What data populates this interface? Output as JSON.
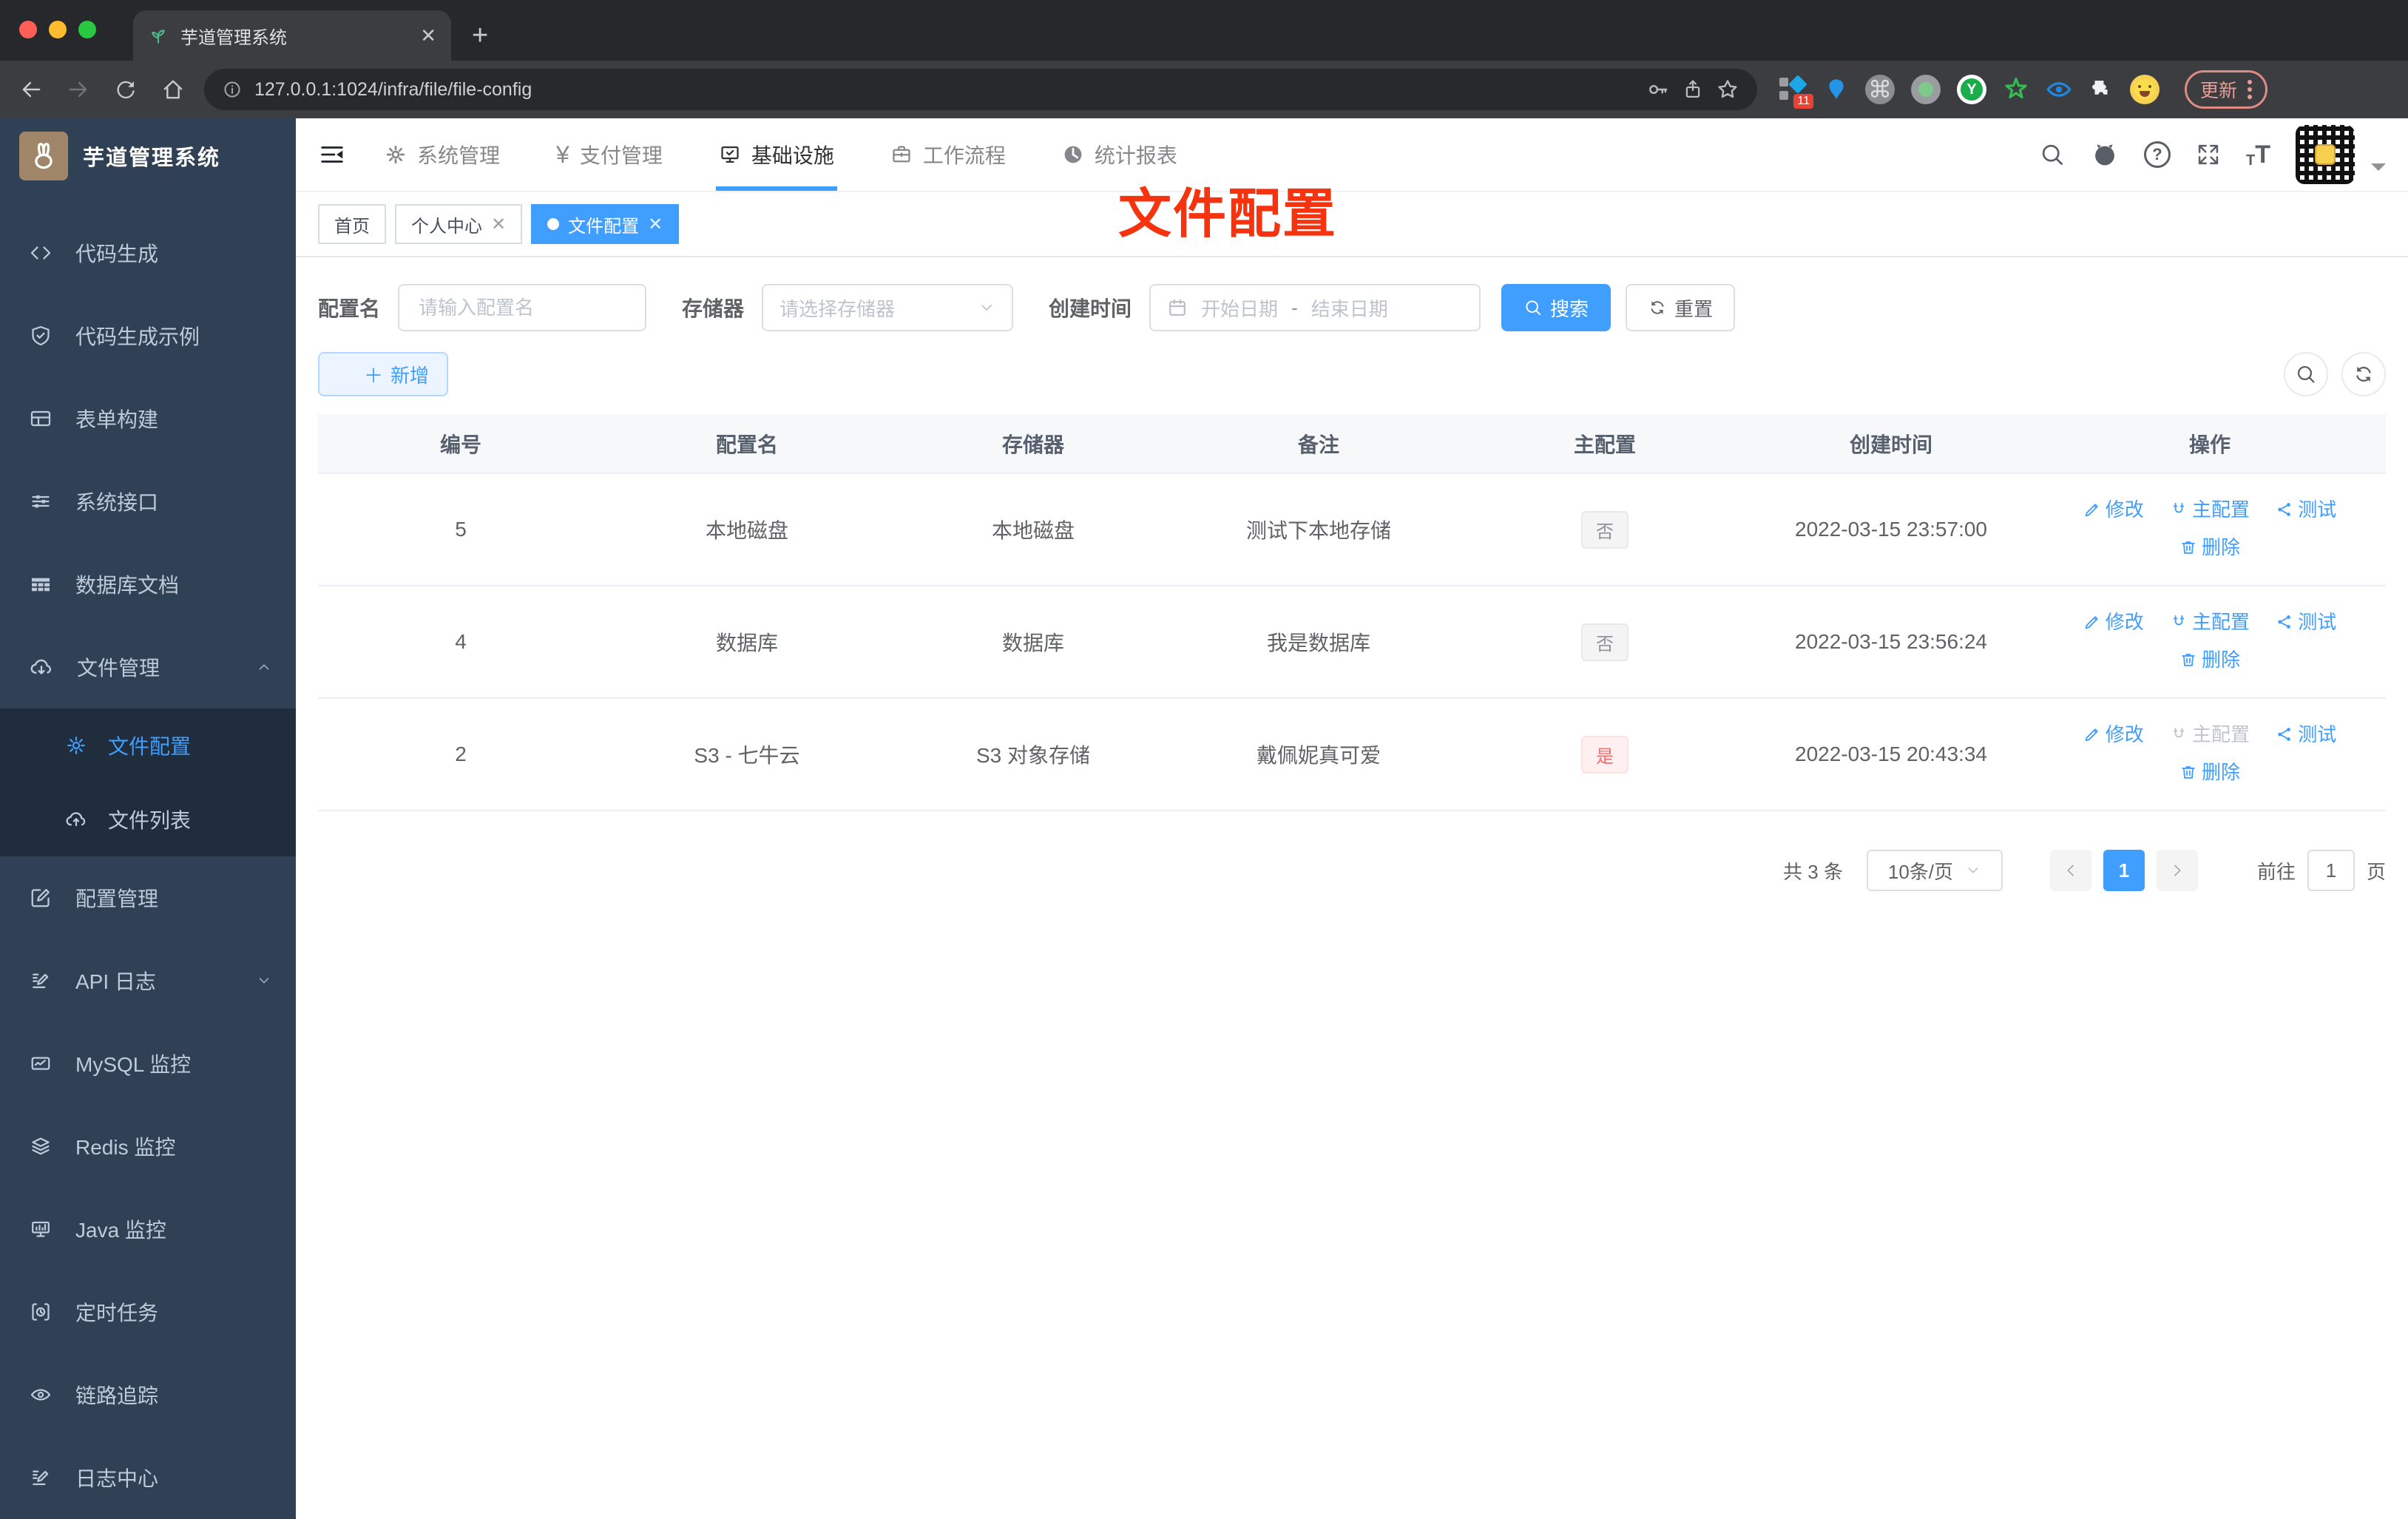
{
  "colors": {
    "primary": "#409eff",
    "annotation_red": "#f5330f",
    "sidebar_bg": "#304156",
    "submenu_bg": "#1f2d3d",
    "tag_danger_text": "#f56c6c",
    "tag_info_text": "#909399"
  },
  "browser": {
    "tab_title": "芋道管理系统",
    "url": "127.0.0.1:1024/infra/file/file-config",
    "update_label": "更新",
    "extension_badge": "11"
  },
  "icons": {
    "yen": "¥",
    "question": "?",
    "font_large": "T",
    "font_small": "T"
  },
  "sidebar": {
    "title": "芋道管理系统",
    "items": [
      "代码生成",
      "代码生成示例",
      "表单构建",
      "系统接口",
      "数据库文档",
      "文件管理",
      "配置管理",
      "API 日志",
      "MySQL 监控",
      "Redis 监控",
      "Java 监控",
      "定时任务",
      "链路追踪",
      "日志中心"
    ],
    "file_children": [
      "文件配置",
      "文件列表"
    ]
  },
  "nav": {
    "items": [
      "系统管理",
      "支付管理",
      "基础设施",
      "工作流程",
      "统计报表"
    ]
  },
  "tags": {
    "items": [
      "首页",
      "个人中心",
      "文件配置"
    ]
  },
  "annotation": "文件配置",
  "filters": {
    "name_label": "配置名",
    "name_placeholder": "请输入配置名",
    "storage_label": "存储器",
    "storage_placeholder": "请选择存储器",
    "date_label": "创建时间",
    "date_start": "开始日期",
    "date_separator": "-",
    "date_end": "结束日期",
    "search": "搜索",
    "reset": "重置"
  },
  "toolbar": {
    "add": "新增"
  },
  "table": {
    "headers": [
      "编号",
      "配置名",
      "存储器",
      "备注",
      "主配置",
      "创建时间",
      "操作"
    ],
    "actions": {
      "edit": "修改",
      "master": "主配置",
      "test": "测试",
      "delete": "删除"
    },
    "rows": [
      {
        "id": "5",
        "name": "本地磁盘",
        "storage": "本地磁盘",
        "remark": "测试下本地存储",
        "master": "否",
        "created": "2022-03-15 23:57:00"
      },
      {
        "id": "4",
        "name": "数据库",
        "storage": "数据库",
        "remark": "我是数据库",
        "master": "否",
        "created": "2022-03-15 23:56:24"
      },
      {
        "id": "2",
        "name": "S3 - 七牛云",
        "storage": "S3 对象存储",
        "remark": "戴佩妮真可爱",
        "master": "是",
        "created": "2022-03-15 20:43:34"
      }
    ]
  },
  "pagination": {
    "total": "共 3 条",
    "page_size": "10条/页",
    "page": "1",
    "goto": "前往",
    "goto_value": "1",
    "unit": "页"
  }
}
